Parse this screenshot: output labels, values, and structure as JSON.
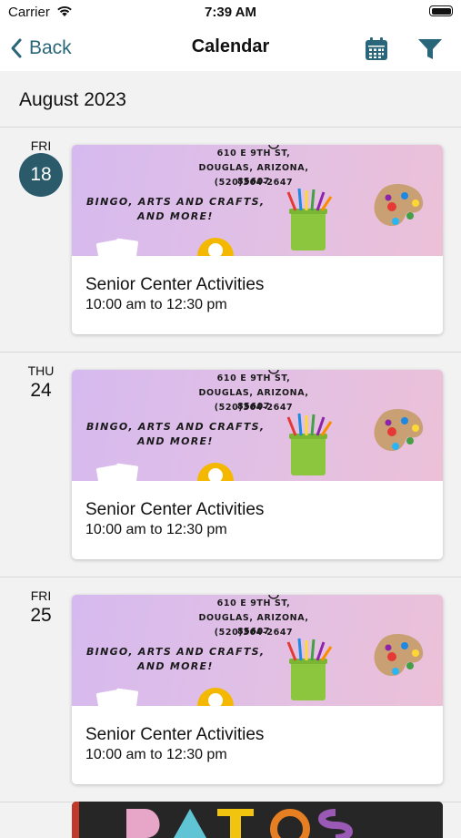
{
  "status_bar": {
    "carrier": "Carrier",
    "time": "7:39 AM"
  },
  "nav": {
    "back_label": "Back",
    "title": "Calendar"
  },
  "month_label": "August 2023",
  "flyer": {
    "address_line1": "610 E 9TH ST,",
    "address_line2": "DOUGLAS, ARIZONA, 85607",
    "address_line3": "(520)364-2647",
    "tagline1": "BINGO, ARTS AND CRAFTS,",
    "tagline2": "AND MORE!"
  },
  "events": [
    {
      "dow": "FRI",
      "day": "18",
      "today": true,
      "title": "Senior Center Activities",
      "time": "10:00 am to 12:30 pm"
    },
    {
      "dow": "THU",
      "day": "24",
      "today": false,
      "title": "Senior Center Activities",
      "time": "10:00 am to 12:30 pm"
    },
    {
      "dow": "FRI",
      "day": "25",
      "today": false,
      "title": "Senior Center Activities",
      "time": "10:00 am to 12:30 pm"
    }
  ],
  "colors": {
    "accent": "#2a6679",
    "today_circle": "#2b5a6b",
    "background": "#f2f2f2"
  },
  "icons": {
    "back": "chevron-left-icon",
    "calendar": "calendar-icon",
    "filter": "filter-icon",
    "wifi": "wifi-icon",
    "battery": "battery-icon"
  }
}
